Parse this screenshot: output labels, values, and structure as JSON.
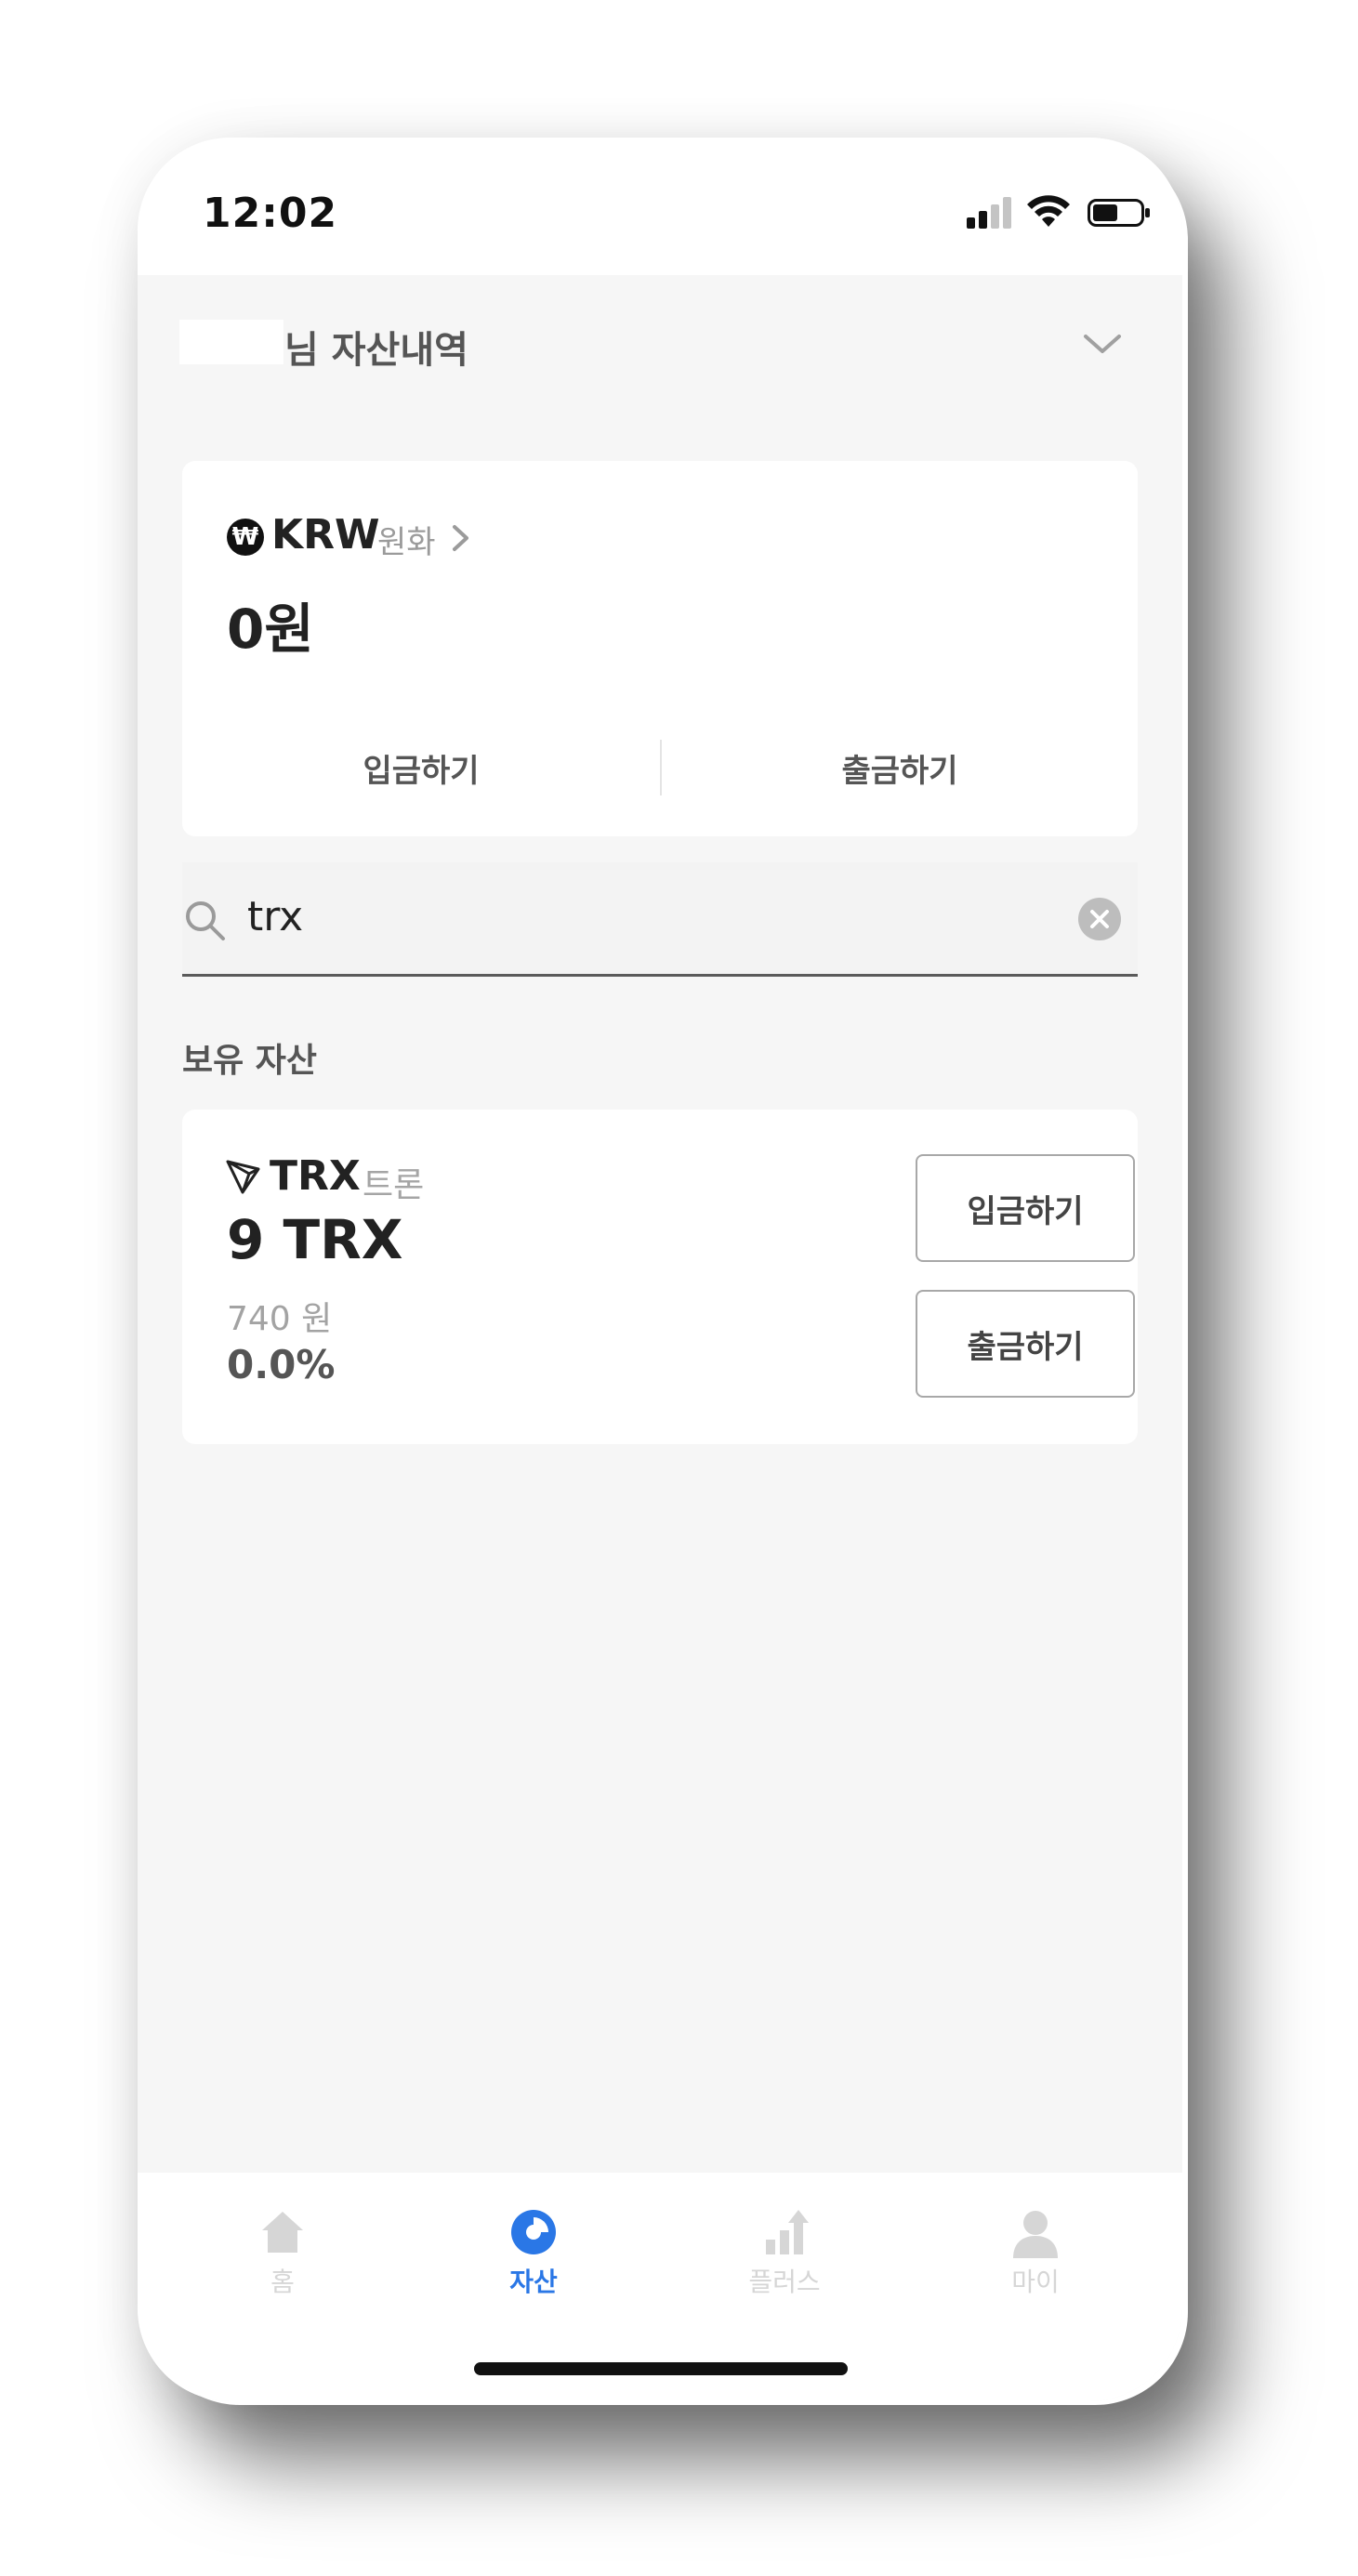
{
  "status_bar": {
    "time": "12:02"
  },
  "header": {
    "title_suffix": "님 자산내역"
  },
  "krw": {
    "code": "KRW",
    "name": "원화",
    "balance": "0원",
    "deposit_label": "입금하기",
    "withdraw_label": "출금하기",
    "icon_symbol": "₩"
  },
  "search": {
    "value": "trx"
  },
  "holdings": {
    "section_title": "보유 자산",
    "items": [
      {
        "code": "TRX",
        "name": "트론",
        "amount": "9 TRX",
        "value": "740 원",
        "rate": "0.0%",
        "deposit_label": "입금하기",
        "withdraw_label": "출금하기"
      }
    ]
  },
  "tabs": [
    {
      "label": "홈",
      "icon": "home-icon",
      "active": false
    },
    {
      "label": "자산",
      "icon": "pie-chart-icon",
      "active": true
    },
    {
      "label": "플러스",
      "icon": "bar-chart-up-icon",
      "active": false
    },
    {
      "label": "마이",
      "icon": "person-icon",
      "active": false
    }
  ],
  "colors": {
    "accent": "#2a77e6",
    "inactive_tab": "#d6d6d6",
    "background": "#f6f6f6"
  }
}
